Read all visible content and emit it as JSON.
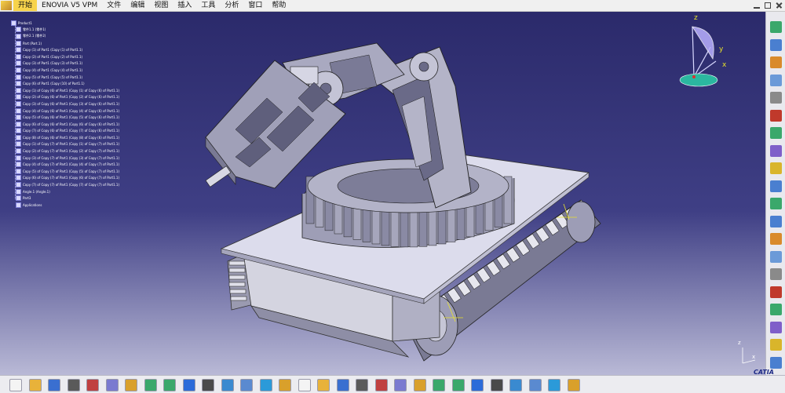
{
  "menu": {
    "items": [
      "开始",
      "ENOVIA V5 VPM",
      "文件",
      "编辑",
      "视图",
      "插入",
      "工具",
      "分析",
      "窗口",
      "帮助"
    ]
  },
  "spec_tree": {
    "rows": [
      "Product1",
      "零件1.1 (零件1)",
      "零件2.1 (零件2)",
      "Part (Part.1)",
      "Copy (1) of Part1 (Copy (1) of Part1.1)",
      "Copy (2) of Part1 (Copy (2) of Part1.1)",
      "Copy (3) of Part1 (Copy (3) of Part1.1)",
      "Copy (4) of Part1 (Copy (4) of Part1.1)",
      "Copy (5) of Part1 (Copy (5) of Part1.1)",
      "Copy (6) of Part1 (Copy (10) of Part1.1)",
      "Copy (1) of Copy (6) of Part1 (Copy (1) of Copy (6) of Part1.1)",
      "Copy (2) of Copy (6) of Part1 (Copy (2) of Copy (6) of Part1.1)",
      "Copy (3) of Copy (6) of Part1 (Copy (3) of Copy (6) of Part1.1)",
      "Copy (4) of Copy (6) of Part1 (Copy (4) of Copy (6) of Part1.1)",
      "Copy (5) of Copy (6) of Part1 (Copy (5) of Copy (6) of Part1.1)",
      "Copy (6) of Copy (6) of Part1 (Copy (6) of Copy (6) of Part1.1)",
      "Copy (7) of Copy (6) of Part1 (Copy (7) of Copy (6) of Part1.1)",
      "Copy (8) of Copy (6) of Part1 (Copy (8) of Copy (6) of Part1.1)",
      "Copy (1) of Copy (7) of Part1 (Copy (1) of Copy (7) of Part1.1)",
      "Copy (2) of Copy (7) of Part1 (Copy (2) of Copy (7) of Part1.1)",
      "Copy (3) of Copy (7) of Part1 (Copy (3) of Copy (7) of Part1.1)",
      "Copy (4) of Copy (7) of Part1 (Copy (4) of Copy (7) of Part1.1)",
      "Copy (5) of Copy (7) of Part1 (Copy (5) of Copy (7) of Part1.1)",
      "Copy (6) of Copy (7) of Part1 (Copy (6) of Copy (7) of Part1.1)",
      "Copy (7) of Copy (7) of Part1 (Copy (7) of Copy (7) of Part1.1)",
      "Angle.1 (Angle.1)",
      "Part3",
      "Applications"
    ]
  },
  "compass": {
    "axis_z": "z",
    "axis_y": "y",
    "axis_x": "x"
  },
  "corner_axis": {
    "axis_z": "z",
    "axis_x": "x"
  },
  "logo_text": "CATIA",
  "colors": {
    "viewport_top": "#2b2a6b",
    "viewport_bottom": "#b9b9d6",
    "menu_active": "#f7d34b"
  },
  "right_toolbar_icons": [
    "product-icon",
    "assembly-icon",
    "component-icon",
    "part-icon",
    "link-icon",
    "manipulate-icon",
    "snap-icon",
    "explode-icon",
    "clash-icon",
    "constraint-icon",
    "coincidence-icon",
    "contact-icon",
    "offset-icon",
    "angle-icon",
    "fix-icon",
    "fix-together-icon",
    "quick-constraint-icon",
    "flexible-icon",
    "reuse-pattern-icon",
    "update-icon"
  ],
  "bottom_toolbar_icons": [
    "new-icon",
    "open-icon",
    "save-icon",
    "print-icon",
    "cut-icon",
    "copy-icon",
    "paste-icon",
    "undo-icon",
    "redo-icon",
    "whats-this-icon",
    "formula-icon",
    "knowledge-icon",
    "catalog-icon",
    "fly-mode-icon",
    "fit-all-icon",
    "pan-icon",
    "rotate-icon",
    "zoom-in-icon",
    "zoom-out-icon",
    "normal-view-icon",
    "iso-view-icon",
    "shading-icon",
    "hide-show-icon",
    "swap-view-icon",
    "measure-icon",
    "sketch-icon",
    "cube-icon",
    "render-icon",
    "grid-icon",
    "scene-icon"
  ]
}
